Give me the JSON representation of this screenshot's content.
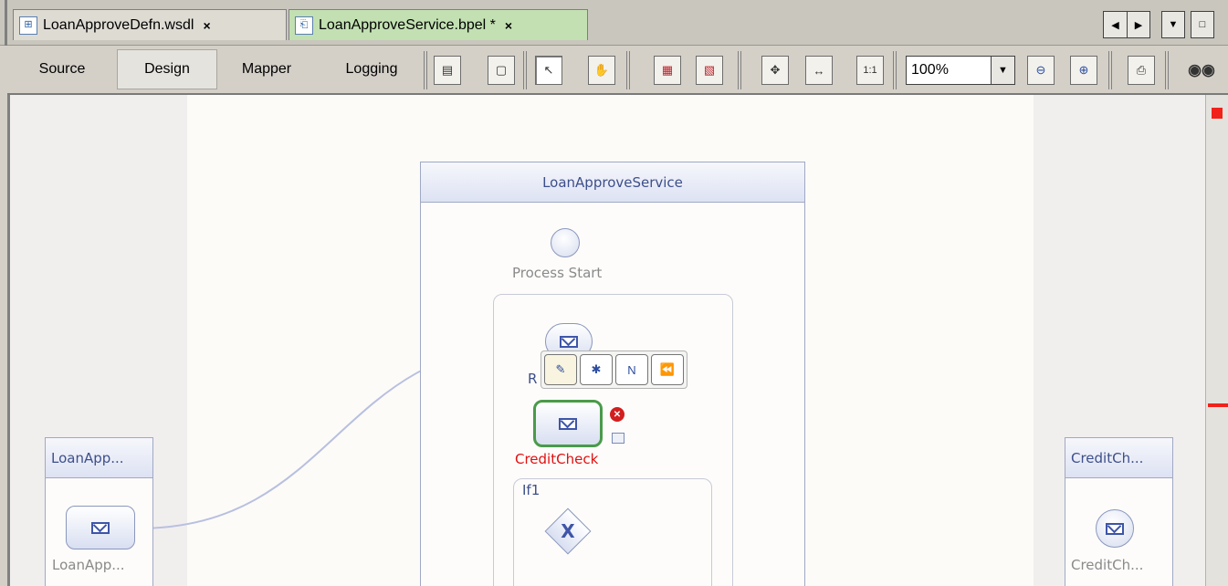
{
  "tabs": [
    {
      "label": "LoanApproveDefn.wsdl",
      "close": "×",
      "icon": "wsdl-file-icon"
    },
    {
      "label": "LoanApproveService.bpel *",
      "close": "×",
      "icon": "bpel-file-icon",
      "active": true
    }
  ],
  "view_tabs": {
    "source": "Source",
    "design": "Design",
    "mapper": "Mapper",
    "logging": "Logging"
  },
  "zoom": {
    "value": "100%"
  },
  "toolbar_icons": [
    "partner-link-icon",
    "selection-rectangle-icon",
    "select-pointer-icon",
    "hand-pan-icon",
    "validate-icon",
    "validate-xml-icon",
    "fit-diagram-icon",
    "fit-width-icon",
    "actual-size-icon",
    "zoom-out-icon",
    "zoom-in-icon",
    "print-icon",
    "search-icon"
  ],
  "actual_size_label": "1:1",
  "diagram": {
    "process_title": "LoanApproveService",
    "process_start": "Process Start",
    "receive_label": "R",
    "invoke_label": "CreditCheck",
    "if_label": "If1",
    "gateway_symbol": "X",
    "left_partner": {
      "title": "LoanApp...",
      "label": "LoanApp..."
    },
    "right_partner": {
      "title": "CreditCh...",
      "label": "CreditCh..."
    }
  },
  "colors": {
    "error": "#e01010",
    "flow": "#f0a040",
    "selected_border": "#4a9a4a",
    "partner_link": "#b8c0e0"
  }
}
